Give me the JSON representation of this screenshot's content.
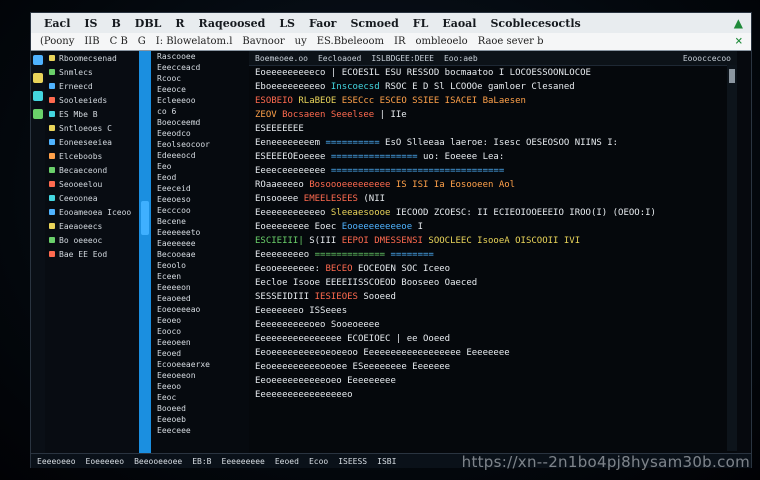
{
  "menubar": {
    "items": [
      "Eacl",
      "IS",
      "B",
      "DBL",
      "R",
      "Raqeoosed",
      "LS",
      "Faor",
      "Scmoed",
      "FL",
      "Eaoal",
      "Scoblecesoctls"
    ]
  },
  "toolbar": {
    "items": [
      "(Poony",
      "IIB",
      "C B",
      "G",
      "I: Blowelatom.l",
      "Bavnoor",
      "uy",
      "ES.Bbeleoom",
      "IR",
      "ombleoelo",
      "Raoe sever b"
    ]
  },
  "sidebar": {
    "items": [
      {
        "label": "Rboomecsenad",
        "icon": "file-icon",
        "color": "#e9d45a"
      },
      {
        "label": "Snmlecs",
        "icon": "folder-icon",
        "color": "#6ad06a"
      },
      {
        "label": "Erneecd",
        "icon": "search-icon",
        "color": "#4fb3ff"
      },
      {
        "label": "Sooleeieds",
        "icon": "git-icon",
        "color": "#ff6a4f"
      },
      {
        "label": "ES Mbe B",
        "icon": "bug-icon",
        "color": "#44d6e0"
      },
      {
        "label": "Sntloeoes C",
        "icon": "extensions-icon",
        "color": "#e9d45a"
      },
      {
        "label": "Eoneeseeiea",
        "icon": "settings-icon",
        "color": "#4fb3ff"
      },
      {
        "label": "Elceboobs",
        "icon": "code-icon",
        "color": "#ffa14a"
      },
      {
        "label": "Becaeceond",
        "icon": "terminal-icon",
        "color": "#6ad06a"
      },
      {
        "label": "Seooeelou",
        "icon": "package-icon",
        "color": "#ff6a4f"
      },
      {
        "label": "Ceeoonea",
        "icon": "test-icon",
        "color": "#44d6e0"
      },
      {
        "label": "Eooameoea Iceoo",
        "icon": "database-icon",
        "color": "#4fb3ff"
      },
      {
        "label": "Eaeaoeecs",
        "icon": "cloud-icon",
        "color": "#e9d45a"
      },
      {
        "label": "Bo oeeeoc",
        "icon": "docs-icon",
        "color": "#6ad06a"
      },
      {
        "label": "Bae EE Eod",
        "icon": "user-icon",
        "color": "#ff6a4f"
      }
    ]
  },
  "gutter": {
    "lines": [
      "Rascooee",
      "Eeecceacd",
      "Rcooc",
      "Eeeoce",
      "Ecleeeoo",
      "co 6",
      "Boeoceemd",
      "Eeeodco",
      "Eeolseocoor",
      "Edeeeocd",
      "Eeo",
      "Eeod",
      "Eeeceid",
      "Eeeoeso",
      "Eecccoo",
      "Becene",
      "Eeeeeeeto",
      "Eaeeeeee",
      "Becooeae",
      "Eeoolo",
      "Eceen",
      "Eeeeeon",
      "Eeaoeed",
      "Eoeoeeeao",
      "Eeoeo",
      "Eooco",
      "Eeeoeen",
      "Eeoed",
      "Ecooeeaerxe",
      "Eeeoeeon",
      "Eeeoo",
      "Eeoc",
      "Booeed",
      "Eeeoeb",
      "Eeeceee"
    ]
  },
  "editor": {
    "tabs": [
      "Boemeoee.oo",
      "Eecloaoed",
      "ISLBDGEE:DEEE",
      "Eoo:aeb"
    ],
    "tab_right": "Eoooccecoo",
    "lines": [
      [
        {
          "t": "Eoeeeeeeeeeco",
          "c": "c-w"
        },
        {
          "t": "  | ECOESIL ESU  RESSOD  bocmaatoo  I LOCOESSOONLOCOE",
          "c": "c-w"
        }
      ],
      [
        {
          "t": "Eboeeeeeeeeeo",
          "c": "c-w"
        },
        {
          "t": "  Inscoecsd  ",
          "c": "c-c"
        },
        {
          "t": "  RSOC E  D  Sl  LCOOOe  gamloer  Clesaned",
          "c": "c-w"
        }
      ],
      [
        {
          "t": "ESOBEIO  ",
          "c": "c-r"
        },
        {
          "t": "RLaBEOE  ",
          "c": "c-y"
        },
        {
          "t": "ESECcc  ESCEO  SSIEE  ISACEI  BaLaesen",
          "c": "c-o"
        }
      ],
      [
        {
          "t": "ZEOV  ",
          "c": "c-o"
        },
        {
          "t": "Bocsaeen Seeelsee",
          "c": "c-r"
        },
        {
          "t": "  | IIe",
          "c": "c-w"
        }
      ],
      [
        {
          "t": "ESEEEEEEE",
          "c": "c-w"
        }
      ],
      [
        {
          "t": "Eeneeeeeeeem  ",
          "c": "c-w"
        },
        {
          "t": "==========",
          "c": "c-b"
        },
        {
          "t": "  EsO Slleeaa  laeroe: Isesc  OESEOSOO NIINS  I:",
          "c": "c-w"
        }
      ],
      [
        {
          "t": "ESEEEEOEoeeee  ",
          "c": "c-w"
        },
        {
          "t": "================",
          "c": "c-b"
        },
        {
          "t": "  uo: Eoeeee  Lea:",
          "c": "c-w"
        }
      ],
      [
        {
          "t": "Eeeeceeeeeeee",
          "c": "c-w"
        },
        {
          "t": "  ================================",
          "c": "c-b"
        }
      ],
      [
        {
          "t": "ROaaeeeeo  ",
          "c": "c-w"
        },
        {
          "t": "Bosoooeeeeeeeee  ",
          "c": "c-r"
        },
        {
          "t": "IS ISI  Ia  Eosooeen  Aol",
          "c": "c-o"
        }
      ],
      [
        {
          "t": "Ensooeee  ",
          "c": "c-w"
        },
        {
          "t": "EMEELESEES  ",
          "c": "c-r"
        },
        {
          "t": "(NII",
          "c": "c-w"
        }
      ],
      [
        {
          "t": "Eeeeeeeeeeeeo  ",
          "c": "c-w"
        },
        {
          "t": "Sleeaesoooe  ",
          "c": "c-y"
        },
        {
          "t": "IECOOD  ZCOESC: II  ECIEOIOOEEEIO  IROO(I)  (OEOO:I)",
          "c": "c-w"
        }
      ],
      [
        {
          "t": "Eoeeeeeeee  ",
          "c": "c-w"
        },
        {
          "t": "Eoec  ",
          "c": "c-w"
        },
        {
          "t": "Eooeeeeeeeeoe  ",
          "c": "c-b"
        },
        {
          "t": "I",
          "c": "c-w"
        }
      ],
      [
        {
          "t": "ESCIEIII|  ",
          "c": "c-g"
        },
        {
          "t": "S(III  ",
          "c": "c-w"
        },
        {
          "t": "EEPOI  DMESSENSI  ",
          "c": "c-r"
        },
        {
          "t": "SOOCLEEC  IsooeA  OISCOOII  IVI",
          "c": "c-y"
        }
      ],
      [
        {
          "t": "Eeeeeeeeeo  ",
          "c": "c-w"
        },
        {
          "t": "=============",
          "c": "c-g"
        },
        {
          "t": "  ========",
          "c": "c-b"
        }
      ],
      [
        {
          "t": "Eeooeeeeeee:  ",
          "c": "c-w"
        },
        {
          "t": "BECEO  ",
          "c": "c-r"
        },
        {
          "t": "EOCEOEN  SOC  Iceeo",
          "c": "c-w"
        }
      ],
      [
        {
          "t": "Eecloe  ",
          "c": "c-w"
        },
        {
          "t": "Isooe  EEEEIISSCOEOD  Booseeo  Oaeced",
          "c": "c-w"
        }
      ],
      [
        {
          "t": "SESSEIDIII  ",
          "c": "c-w"
        },
        {
          "t": "IESIEOES  ",
          "c": "c-r"
        },
        {
          "t": "Sooeed",
          "c": "c-w"
        }
      ],
      [
        {
          "t": "Eeeeeeeeo  ",
          "c": "c-w"
        },
        {
          "t": "ISSeees",
          "c": "c-w"
        }
      ],
      [
        {
          "t": "Eeeeeeeeeeoeo  ",
          "c": "c-w"
        },
        {
          "t": "Sooeoeeee",
          "c": "c-w"
        }
      ],
      [
        {
          "t": "Eeeeeeeeeeeeeeee  ",
          "c": "c-w"
        },
        {
          "t": "ECOEIOEC  | ee  Ooeed",
          "c": "c-w"
        }
      ],
      [
        {
          "t": "Eeoeeeeeeeeeoeoeeoo  ",
          "c": "c-w"
        },
        {
          "t": "Eeeeeeeeeeeeeeeeee  Eeeeeeee",
          "c": "c-w"
        }
      ],
      [
        {
          "t": "Eeoeeeeeeeeeoeoee  ",
          "c": "c-w"
        },
        {
          "t": "ESeeeeeeee  Eeeeeee",
          "c": "c-w"
        }
      ],
      [
        {
          "t": "Eeoeeeeeeeeeeoeo  ",
          "c": "c-w"
        },
        {
          "t": "Eeeeeeeee",
          "c": "c-w"
        }
      ],
      [
        {
          "t": "Eeeeeeeeeeeeeeeeeo",
          "c": "c-w"
        }
      ]
    ]
  },
  "statusbar": {
    "items": [
      "Eeeeoeeo",
      "Eoeeeeeo",
      "Beeooeeoee",
      "EB:B",
      "Eeeeeeeee",
      "Eeoed",
      "Ecoo",
      "ISEESS",
      "ISBI"
    ]
  },
  "watermark": "https://xn--2n1bo4pj8hysam30b.com",
  "colors": {
    "accent": "#1b8fe0",
    "menu_bg": "#e8ecef",
    "editor_bg": "#05080c"
  }
}
